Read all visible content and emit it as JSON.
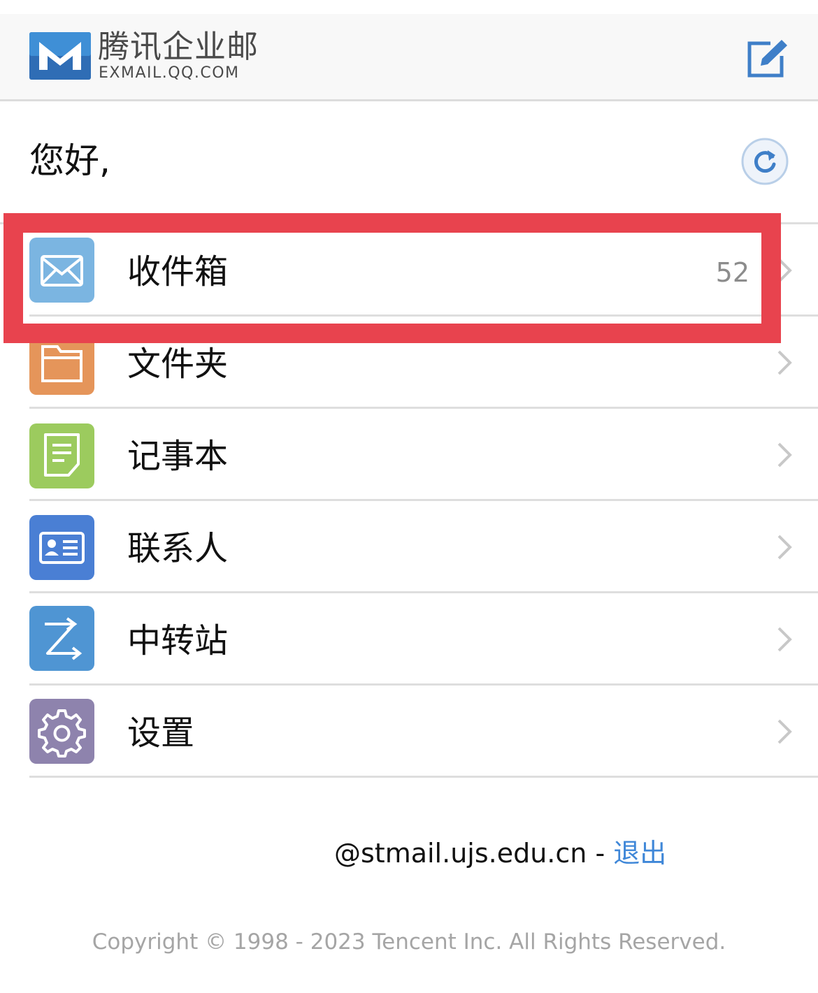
{
  "header": {
    "logo_cn": "腾讯企业邮",
    "logo_en": "EXMAIL.QQ.COM",
    "compose_icon": "compose-edit-icon",
    "accent_color": "#3f7fc8"
  },
  "greeting": {
    "text": "您好,",
    "refresh_icon": "refresh-icon"
  },
  "menu": {
    "items": [
      {
        "label": "收件箱",
        "count": "52",
        "icon": "envelope-icon",
        "color": "#7bb5e1"
      },
      {
        "label": "文件夹",
        "count": "",
        "icon": "folder-icon",
        "color": "#e5955a"
      },
      {
        "label": "记事本",
        "count": "",
        "icon": "note-icon",
        "color": "#9ccb5e"
      },
      {
        "label": "联系人",
        "count": "",
        "icon": "contact-card-icon",
        "color": "#4a7fd4"
      },
      {
        "label": "中转站",
        "count": "",
        "icon": "transfer-icon",
        "color": "#4f95d3"
      },
      {
        "label": "设置",
        "count": "",
        "icon": "gear-icon",
        "color": "#8e83ad"
      }
    ]
  },
  "footer": {
    "account": "@stmail.ujs.edu.cn",
    "separator": " - ",
    "logout_label": "退出",
    "copyright": "Copyright © 1998 - 2023 Tencent Inc. All Rights Reserved."
  },
  "highlight_color": "#e8434e"
}
